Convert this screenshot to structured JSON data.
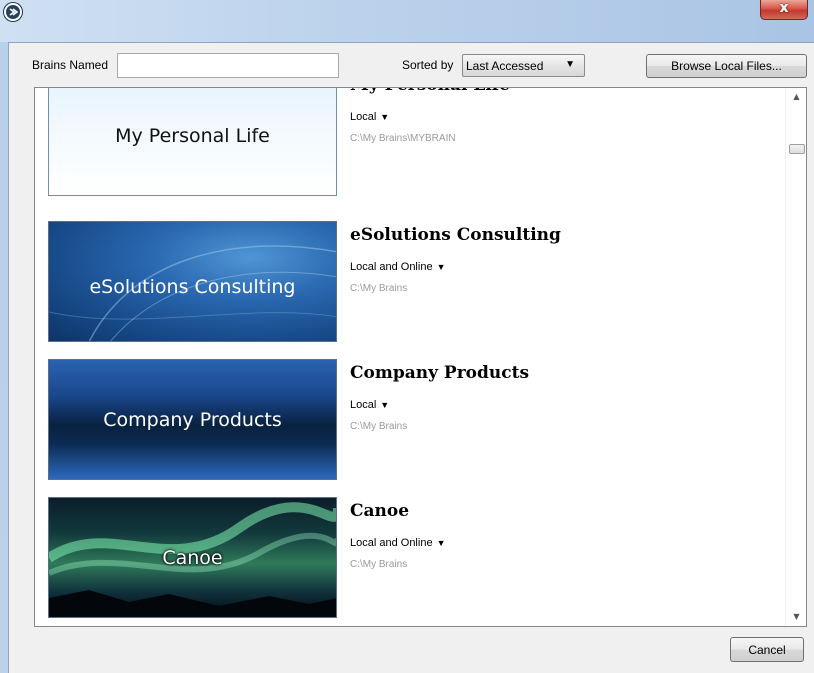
{
  "window": {
    "close_label": "x"
  },
  "toolbar": {
    "brains_named_label": "Brains Named",
    "brains_named_value": "",
    "sorted_by_label": "Sorted by",
    "sorted_by_value": "Last Accessed",
    "browse_label": "Browse Local Files..."
  },
  "brains": [
    {
      "thumb_text": "My Personal Life",
      "title": "My Personal Life",
      "location": "Local",
      "path": "C:\\My Brains\\MYBRAIN"
    },
    {
      "thumb_text": "eSolutions Consulting",
      "title": "eSolutions Consulting",
      "location": "Local and Online",
      "path": "C:\\My Brains"
    },
    {
      "thumb_text": "Company Products",
      "title": "Company Products",
      "location": "Local",
      "path": "C:\\My Brains"
    },
    {
      "thumb_text": "Canoe",
      "title": "Canoe",
      "location": "Local and Online",
      "path": "C:\\My Brains"
    }
  ],
  "footer": {
    "cancel_label": "Cancel"
  },
  "colors": {
    "accent": "#1f4e94",
    "close_red": "#c9463a"
  }
}
